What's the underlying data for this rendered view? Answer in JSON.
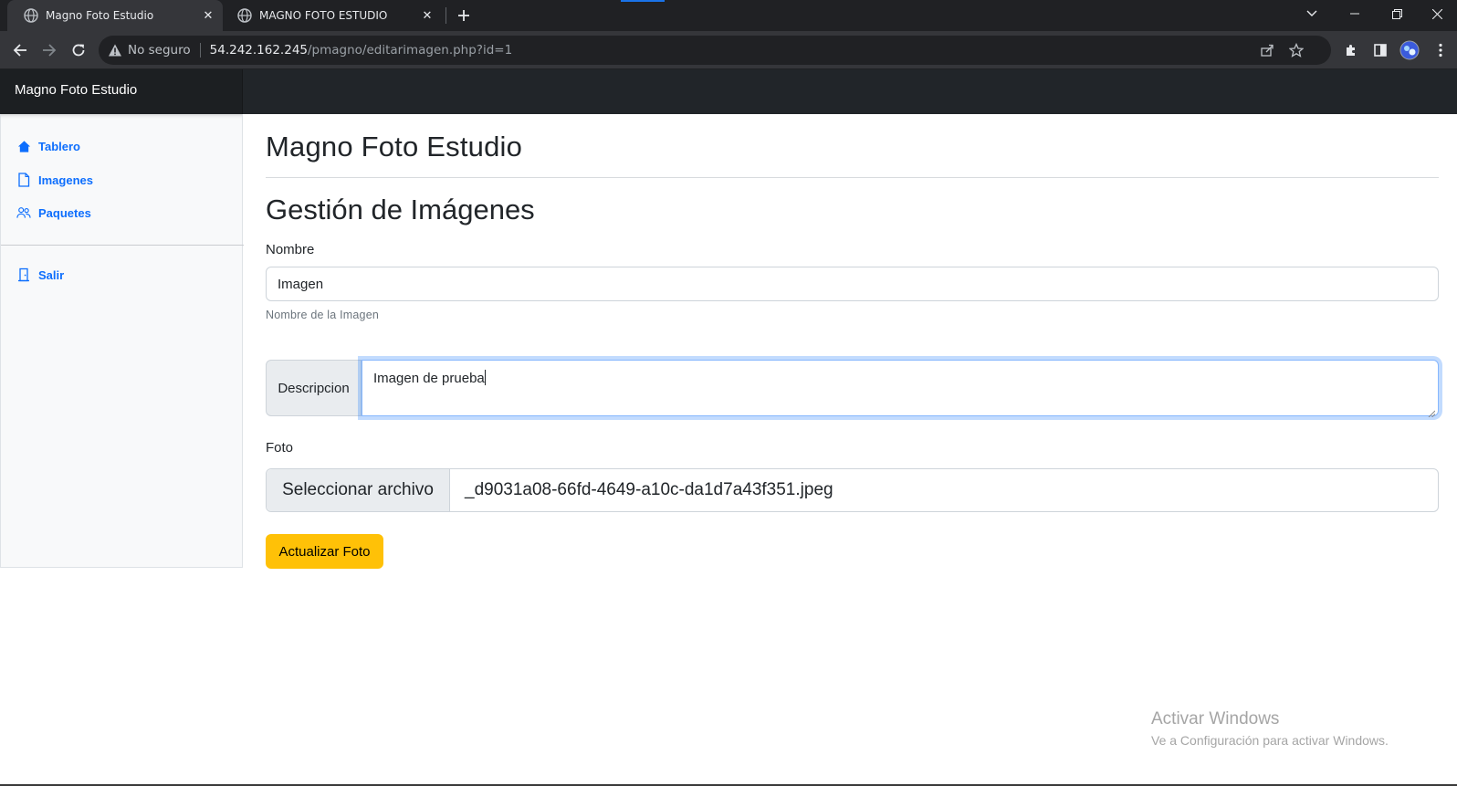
{
  "browser": {
    "tabs": [
      {
        "title": "Magno Foto Estudio",
        "active": true
      },
      {
        "title": "MAGNO FOTO ESTUDIO",
        "active": false
      }
    ],
    "omnibox": {
      "security_label": "No seguro",
      "host": "54.242.162.245",
      "path": "/pmagno/editarimagen.php?id=1"
    }
  },
  "navbar": {
    "brand": "Magno Foto Estudio"
  },
  "sidebar": {
    "items": [
      {
        "label": "Tablero",
        "icon": "house-icon"
      },
      {
        "label": "Imagenes",
        "icon": "file-icon"
      },
      {
        "label": "Paquetes",
        "icon": "people-icon"
      }
    ],
    "logout": {
      "label": "Salir",
      "icon": "door-icon"
    }
  },
  "main": {
    "brand_heading": "Magno Foto Estudio",
    "section_heading": "Gestión de Imágenes",
    "nombre": {
      "label": "Nombre",
      "value": "Imagen",
      "help": "Nombre de la Imagen"
    },
    "descripcion": {
      "label": "Descripcion",
      "value": "Imagen de prueba"
    },
    "foto": {
      "label": "Foto",
      "button": "Seleccionar archivo",
      "filename": "_d9031a08-66fd-4649-a10c-da1d7a43f351.jpeg"
    },
    "submit_label": "Actualizar Foto"
  },
  "watermark": {
    "title": "Activar Windows",
    "subtitle": "Ve a Configuración para activar Windows."
  },
  "colors": {
    "primary": "#0d6efd",
    "warning": "#ffc107",
    "navbar": "#212529",
    "sidebar_bg": "#f8f9fa"
  }
}
